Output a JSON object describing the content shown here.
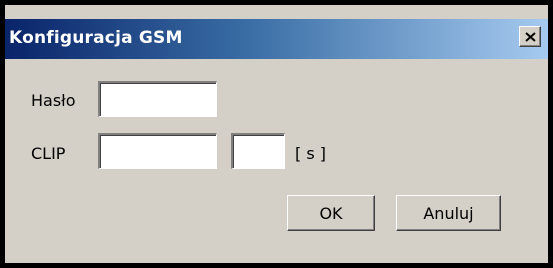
{
  "window": {
    "title": "Konfiguracja GSM",
    "close_glyph": "×"
  },
  "fields": {
    "haslo_label": "Hasło",
    "haslo_value": "",
    "clip_label": "CLIP",
    "clip_number_value": "",
    "clip_time_value": "",
    "clip_unit": "[ s ]"
  },
  "buttons": {
    "ok_label": "OK",
    "cancel_label": "Anuluj"
  },
  "colors": {
    "dialog_face": "#d4d0c8",
    "title_gradient_start": "#0a246a",
    "title_gradient_end": "#a6caf0",
    "title_text": "#ffffff"
  },
  "icons": {
    "close": "close-icon"
  }
}
